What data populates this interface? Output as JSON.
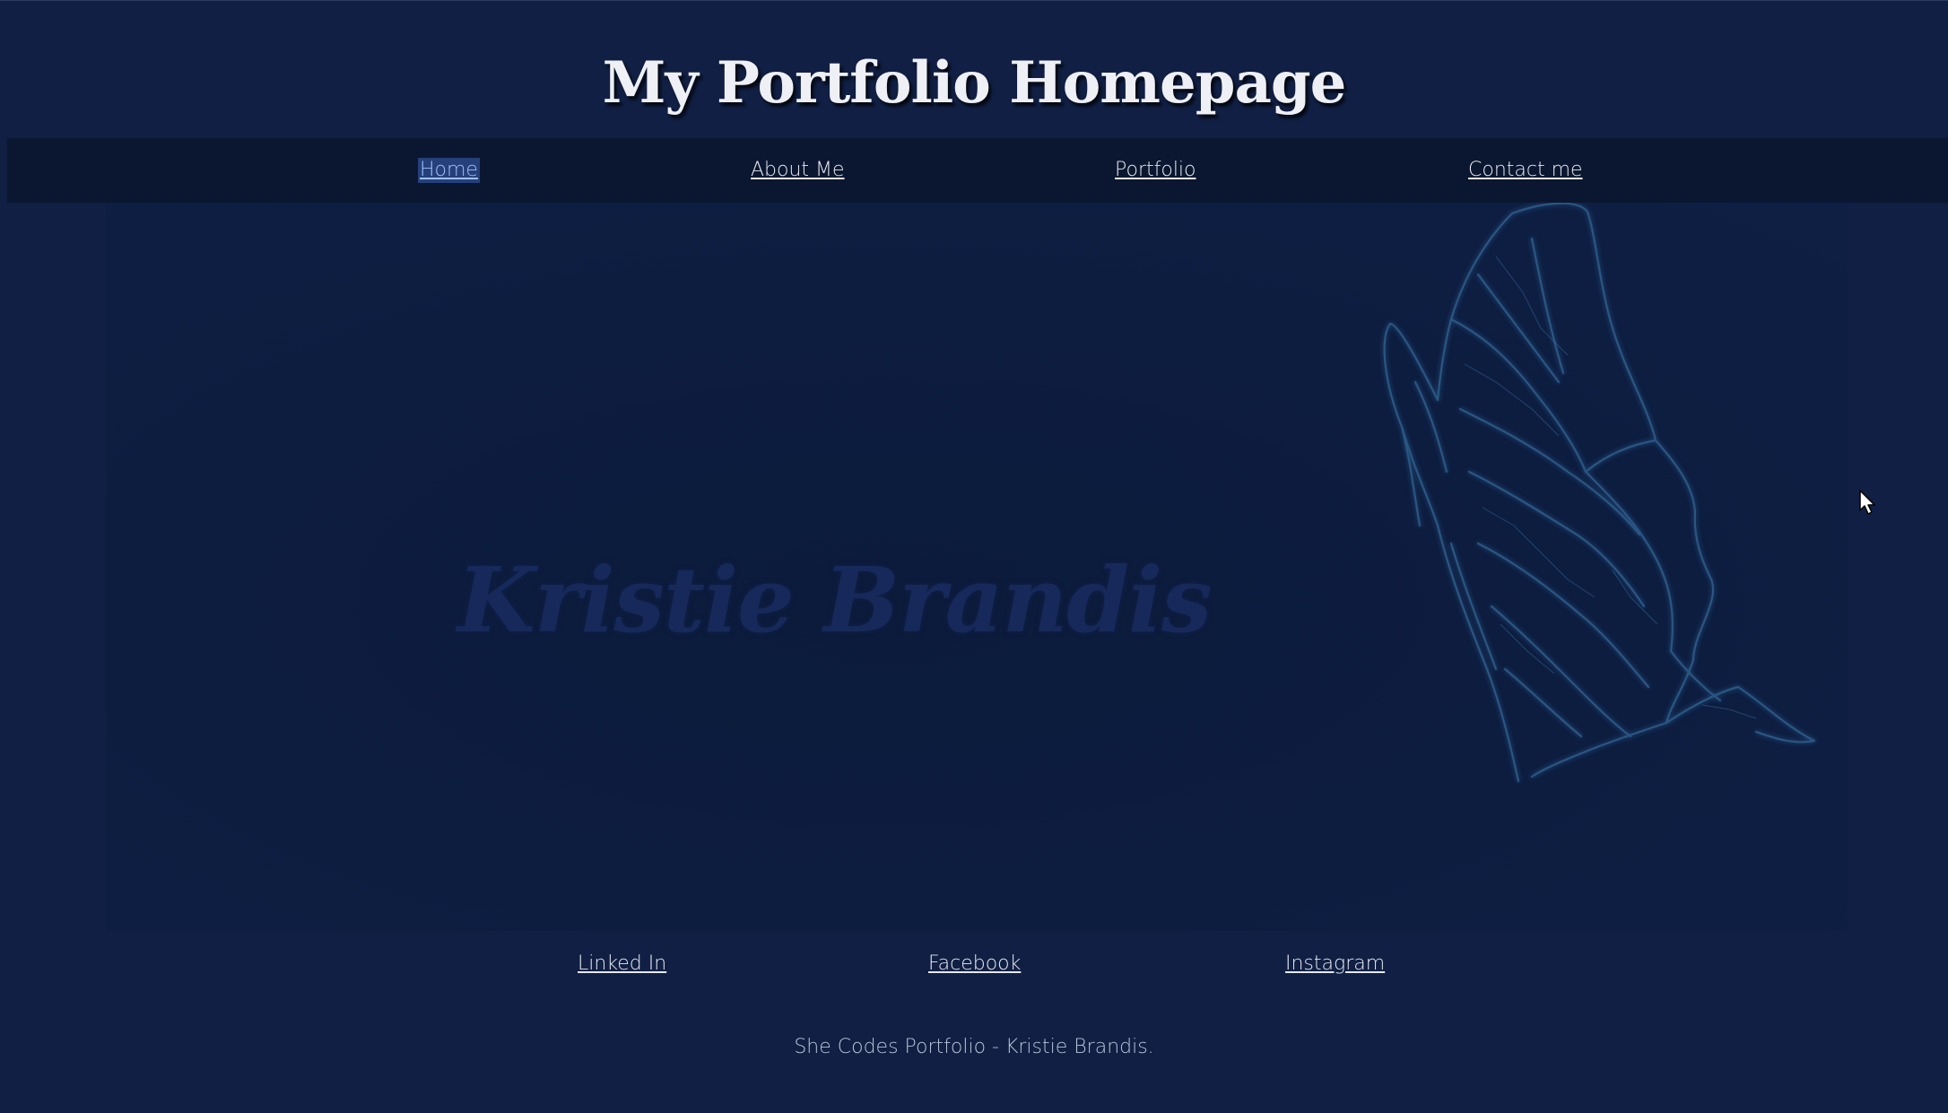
{
  "header": {
    "title": "My Portfolio Homepage"
  },
  "nav": {
    "items": [
      {
        "label": "Home",
        "active": true
      },
      {
        "label": "About Me",
        "active": false
      },
      {
        "label": "Portfolio",
        "active": false
      },
      {
        "label": "Contact me",
        "active": false
      }
    ]
  },
  "hero": {
    "name": "Kristie Brandis",
    "image_icon": "butterfly-icon"
  },
  "social": {
    "items": [
      {
        "label": "Linked In"
      },
      {
        "label": "Facebook"
      },
      {
        "label": "Instagram"
      }
    ]
  },
  "footer": {
    "text": "She Codes Portfolio - Kristie Brandis."
  },
  "colors": {
    "background": "#101f43",
    "navbar": "#0b1730",
    "active_highlight": "#25407a",
    "text": "#e6e9f2",
    "butterfly": "#2f6190"
  }
}
